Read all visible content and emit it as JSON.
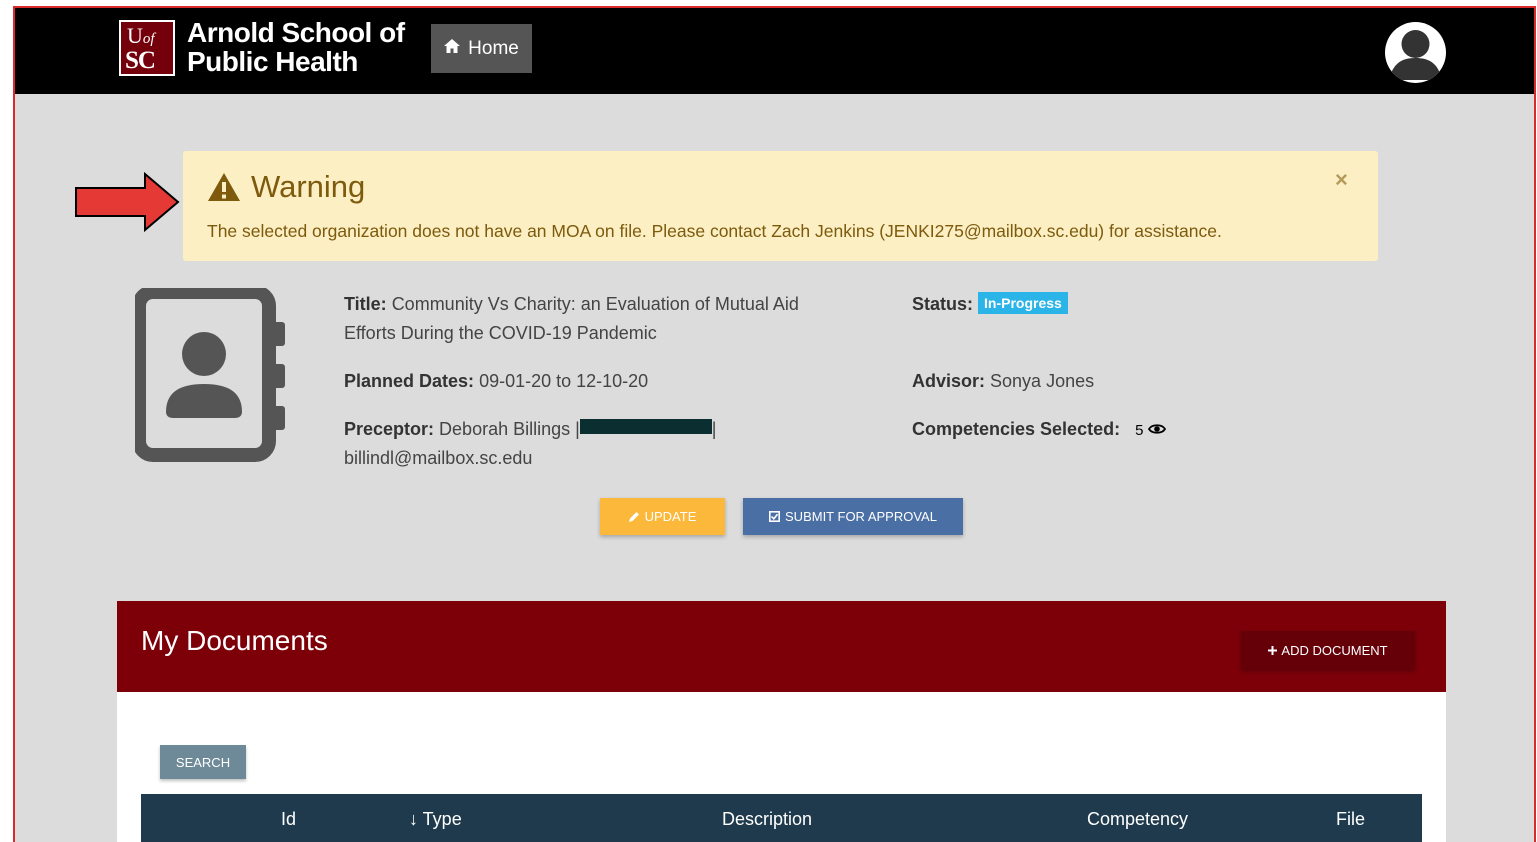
{
  "header": {
    "logo_top": "U",
    "logo_top_small": "of",
    "logo_bottom": "SC",
    "brand_line1": "Arnold School of",
    "brand_line2": "Public Health",
    "home_label": "Home",
    "home_icon": "home-icon"
  },
  "warning": {
    "title": "Warning",
    "message": "The selected organization does not have an MOA on file. Please contact Zach Jenkins (JENKI275@mailbox.sc.edu) for assistance.",
    "close_glyph": "×",
    "bg_color": "#fcefc4",
    "text_color": "#7d5a0c"
  },
  "project": {
    "title_label": "Title:",
    "title_line1": "Community Vs Charity: an Evaluation of Mutual Aid",
    "title_line2": "Efforts During the COVID-19 Pandemic",
    "dates_label": "Planned Dates:",
    "dates_value": "09-01-20 to 12-10-20",
    "preceptor_label": "Preceptor:",
    "preceptor_name": "Deborah Billings |",
    "preceptor_sep": "|",
    "preceptor_email": "billindl@mailbox.sc.edu",
    "status_label": "Status:",
    "status_value": "In-Progress",
    "advisor_label": "Advisor:",
    "advisor_value": "Sonya Jones",
    "competencies_label": "Competencies Selected:",
    "competencies_count": "5"
  },
  "actions": {
    "update_label": "UPDATE",
    "submit_label": "SUBMIT FOR APPROVAL"
  },
  "documents": {
    "title": "My Documents",
    "add_label": "ADD DOCUMENT",
    "search_label": "SEARCH",
    "columns": [
      "Id",
      "↓ Type",
      "Description",
      "Competency",
      "File"
    ]
  },
  "colors": {
    "garnet": "#7d0009",
    "table_header": "#1e3a4c",
    "update_btn": "#fbb83a",
    "submit_btn": "#4a6fa5",
    "status_badge": "#2ab4e8"
  }
}
